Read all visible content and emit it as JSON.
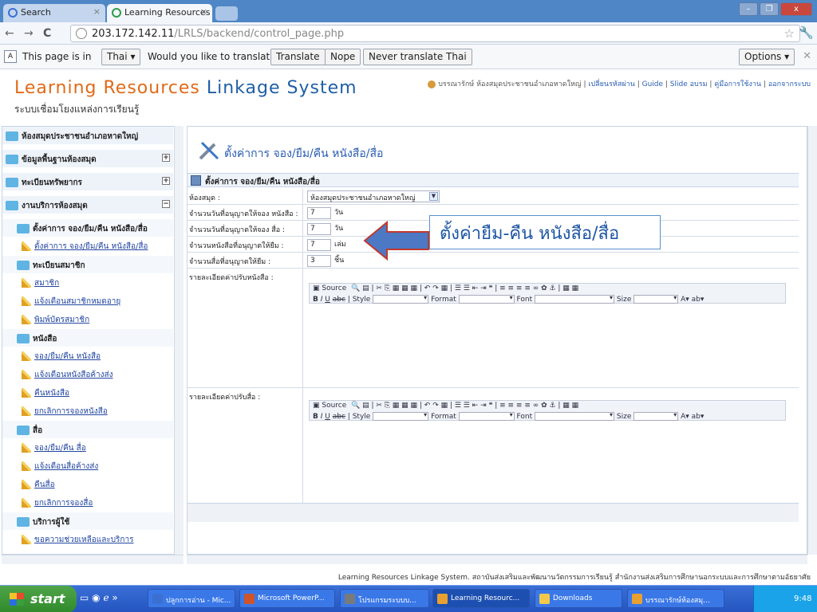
{
  "browser": {
    "tabs": [
      {
        "label": "Search",
        "active": false
      },
      {
        "label": "Learning Resources Linkage S\\",
        "active": true
      }
    ],
    "url_host": "203.172.142.11",
    "url_path": "/LRLS/backend/control_page.php",
    "translate_bar": {
      "prefix": "This page is in",
      "language": "Thai",
      "question": "Would you like to translate it?",
      "translate_btn": "Translate",
      "nope_btn": "Nope",
      "never_btn": "Never translate Thai",
      "options_btn": "Options"
    }
  },
  "header": {
    "logo_part1": "Learning Resources",
    "logo_part2": "Linkage System",
    "subtitle": "ระบบเชื่อมโยงแหล่งการเรียนรู้",
    "user": "บรรณารักษ์ ห้องสมุดประชาชนอำเภอหาดใหญ่",
    "links": [
      "เปลี่ยนรหัสผ่าน",
      "Guide",
      "Slide อบรม",
      "คู่มือการใช้งาน",
      "ออกจากระบบ"
    ]
  },
  "sidebar": {
    "items": [
      {
        "type": "head",
        "label": "ห้องสมุดประชาชนอำเภอหาดใหญ่",
        "pm": ""
      },
      {
        "type": "head",
        "label": "ข้อมูลพื้นฐานห้องสมุด",
        "pm": "+"
      },
      {
        "type": "head",
        "label": "ทะเบียนทรัพยากร",
        "pm": "+"
      },
      {
        "type": "head",
        "label": "งานบริการห้องสมุด",
        "pm": "−"
      },
      {
        "type": "sub",
        "label": "ตั้งค่าการ จอง/ยืม/คืน หนังสือ/สื่อ"
      },
      {
        "type": "link",
        "label": "ตั้งค่าการ จอง/ยืม/คืน หนังสือ/สื่อ"
      },
      {
        "type": "sub",
        "label": "ทะเบียนสมาชิก"
      },
      {
        "type": "link",
        "label": "สมาชิก"
      },
      {
        "type": "link",
        "label": "แจ้งเตือนสมาชิกหมดอายุ"
      },
      {
        "type": "link",
        "label": "พิมพ์บัตรสมาชิก"
      },
      {
        "type": "sub",
        "label": "หนังสือ"
      },
      {
        "type": "link",
        "label": "จอง/ยืม/คืน หนังสือ"
      },
      {
        "type": "link",
        "label": "แจ้งเตือนหนังสือค้างส่ง"
      },
      {
        "type": "link",
        "label": "คืนหนังสือ"
      },
      {
        "type": "link",
        "label": "ยกเลิกการจองหนังสือ"
      },
      {
        "type": "sub",
        "label": "สื่อ"
      },
      {
        "type": "link",
        "label": "จอง/ยืม/คืน สื่อ"
      },
      {
        "type": "link",
        "label": "แจ้งเตือนสื่อค้างส่ง"
      },
      {
        "type": "link",
        "label": "คืนสื่อ"
      },
      {
        "type": "link",
        "label": "ยกเลิกการจองสื่อ"
      },
      {
        "type": "sub",
        "label": "บริการผู้ใช้"
      },
      {
        "type": "link",
        "label": "ขอความช่วยเหลือและบริการ"
      }
    ]
  },
  "main": {
    "title": "ตั้งค่าการ จอง/ยืม/คืน หนังสือ/สื่อ",
    "form_title": "ตั้งค่าการ จอง/ยืม/คืน หนังสือ/สื่อ",
    "library_label": "ห้องสมุด :",
    "library_value": "ห้องสมุดประชาชนอำเภอหาดใหญ่",
    "rows": [
      {
        "label": "จำนวนวันที่อนุญาตให้จอง หนังสือ :",
        "value": "7",
        "unit": "วัน"
      },
      {
        "label": "จำนวนวันที่อนุญาตให้จอง สื่อ :",
        "value": "7",
        "unit": "วัน"
      },
      {
        "label": "จำนวนหนังสือที่อนุญาตให้ยืม :",
        "value": "7",
        "unit": "เล่ม"
      },
      {
        "label": "จำนวนสื่อที่อนุญาตให้ยืม :",
        "value": "3",
        "unit": "ชิ้น"
      }
    ],
    "fine_book_label": "รายละเอียดค่าปรับหนังสือ :",
    "fine_media_label": "รายละเอียดค่าปรับสื่อ :",
    "editor": {
      "source": "Source",
      "style": "Style",
      "format": "Format",
      "font": "Font",
      "size": "Size"
    }
  },
  "annotation": "ตั้งค่ายืม-คืน หนังสือ/สื่อ",
  "footer": "Learning Resources Linkage System. สถาบันส่งเสริมและพัฒนานวัตกรรมการเรียนรู้ สำนักงานส่งเสริมการศึกษานอกระบบและการศึกษาตามอัธยาศัย",
  "taskbar": {
    "start": "start",
    "apps": [
      {
        "label": "ปลูกการอ่าน - Mic...",
        "color": "#3c6fd0"
      },
      {
        "label": "Microsoft PowerP...",
        "color": "#d0542a"
      },
      {
        "label": "โปรแกรมระบบบ...",
        "color": "#7a7a7a"
      },
      {
        "label": "Learning Resourc...",
        "color": "#e8a030"
      },
      {
        "label": "Downloads",
        "color": "#f2c84a"
      },
      {
        "label": "บรรณารักษ์ห้องสมุ...",
        "color": "#e8a030"
      }
    ],
    "clock": "9:48"
  }
}
